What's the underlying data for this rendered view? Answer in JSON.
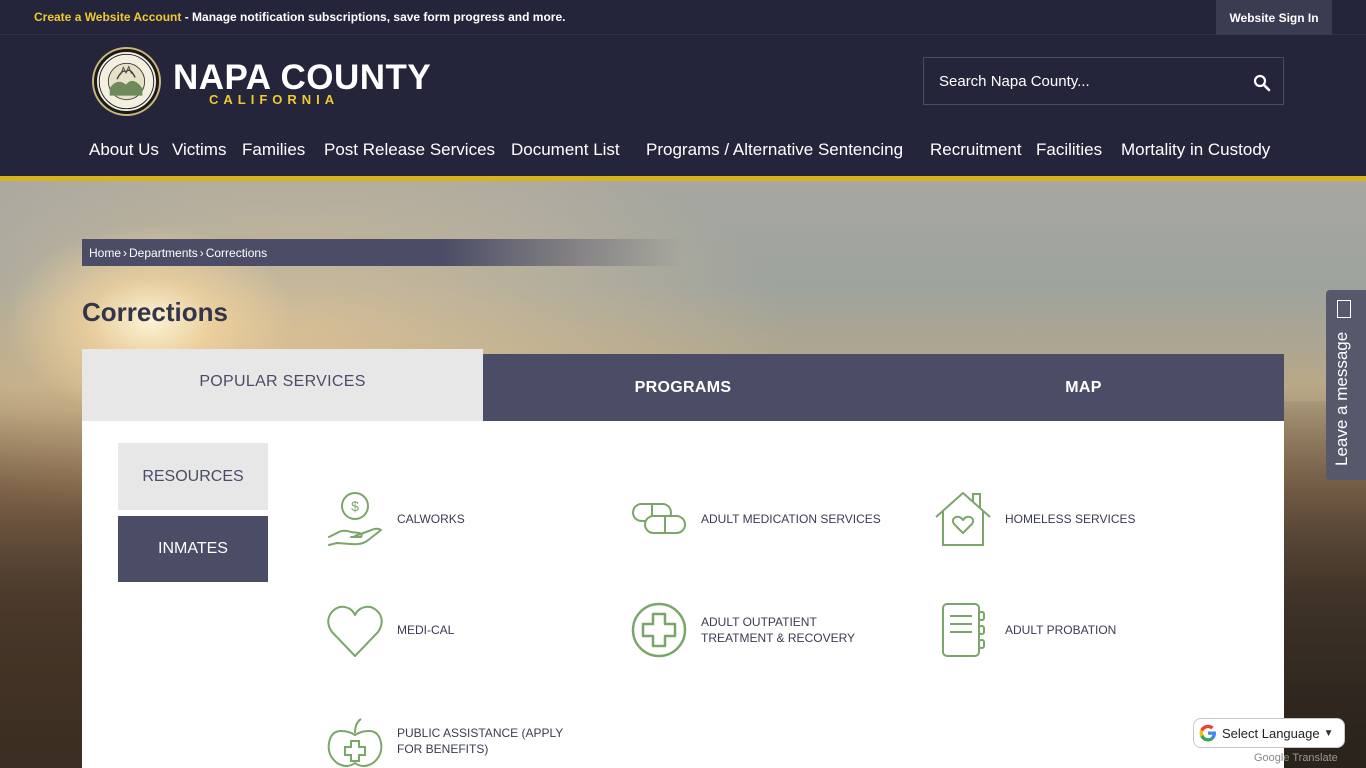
{
  "topbar": {
    "account_link": "Create a Website Account",
    "message": " - Manage notification subscriptions, save form progress and more.",
    "signin": "Website Sign In"
  },
  "header": {
    "brand_name": "NAPA COUNTY",
    "brand_sub": "CALIFORNIA",
    "search_placeholder": "Search Napa County..."
  },
  "nav": {
    "items": [
      "About Us",
      "Victims",
      "Families",
      "Post Release Services",
      "Document List",
      "Programs / Alternative Sentencing",
      "Recruitment",
      "Facilities",
      "Mortality in Custody"
    ]
  },
  "breadcrumb": {
    "home": "Home",
    "departments": "Departments",
    "current": "Corrections",
    "sep": "›"
  },
  "page_title": "Corrections",
  "tabs": {
    "popular": "POPULAR SERVICES",
    "programs": "PROGRAMS",
    "map": "MAP"
  },
  "side": {
    "resources": "RESOURCES",
    "inmates": "INMATES"
  },
  "services": [
    {
      "label": "CALWORKS",
      "icon": "hand-dollar-icon"
    },
    {
      "label": "ADULT MEDICATION SERVICES",
      "icon": "pill-icon"
    },
    {
      "label": "HOMELESS SERVICES",
      "icon": "house-heart-icon"
    },
    {
      "label": "MEDI-CAL",
      "icon": "heart-icon"
    },
    {
      "label": "ADULT OUTPATIENT TREATMENT & RECOVERY",
      "icon": "medical-cross-icon"
    },
    {
      "label": "ADULT PROBATION",
      "icon": "notebook-icon"
    },
    {
      "label": "PUBLIC ASSISTANCE (APPLY FOR BENEFITS)",
      "icon": "apple-heart-icon"
    }
  ],
  "widgets": {
    "leave_message": "Leave a message",
    "translate": "Select Language",
    "powered_google": "Google",
    "powered_translate": " Translate"
  },
  "colors": {
    "header_bg": "#24253a",
    "accent_gold": "#d7b41e",
    "tab_dark": "#4b4d66",
    "tab_light": "#e8e7e8",
    "icon_green": "#7aa66a"
  }
}
